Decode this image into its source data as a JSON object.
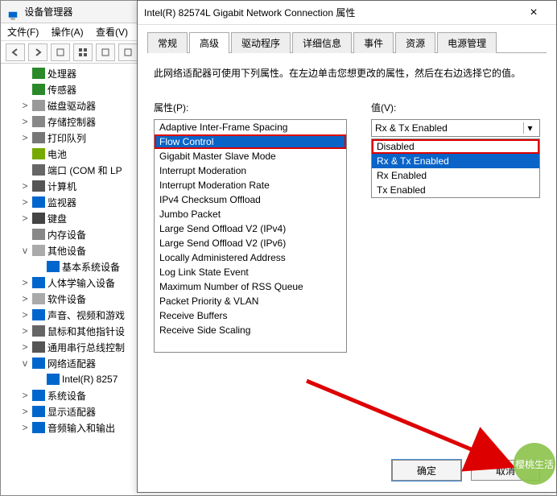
{
  "dm": {
    "title": "设备管理器",
    "menu": {
      "file": "文件(F)",
      "action": "操作(A)",
      "view": "查看(V)"
    },
    "tree": [
      {
        "exp": "",
        "icon": "ic-cpu",
        "label": "处理器",
        "indent": 1
      },
      {
        "exp": "",
        "icon": "ic-sensor",
        "label": "传感器",
        "indent": 1
      },
      {
        "exp": ">",
        "icon": "ic-disk",
        "label": "磁盘驱动器",
        "indent": 1
      },
      {
        "exp": ">",
        "icon": "ic-store",
        "label": "存储控制器",
        "indent": 1
      },
      {
        "exp": ">",
        "icon": "ic-print",
        "label": "打印队列",
        "indent": 1
      },
      {
        "exp": "",
        "icon": "ic-batt",
        "label": "电池",
        "indent": 1
      },
      {
        "exp": "",
        "icon": "ic-port",
        "label": "端口 (COM 和 LP",
        "indent": 1
      },
      {
        "exp": ">",
        "icon": "ic-pc",
        "label": "计算机",
        "indent": 1
      },
      {
        "exp": ">",
        "icon": "ic-mon",
        "label": "监视器",
        "indent": 1
      },
      {
        "exp": ">",
        "icon": "ic-kb",
        "label": "键盘",
        "indent": 1
      },
      {
        "exp": "",
        "icon": "ic-mem",
        "label": "内存设备",
        "indent": 1
      },
      {
        "exp": "v",
        "icon": "ic-other",
        "label": "其他设备",
        "indent": 1
      },
      {
        "exp": "",
        "icon": "ic-sys",
        "label": "基本系统设备",
        "indent": 2
      },
      {
        "exp": ">",
        "icon": "ic-hid",
        "label": "人体学输入设备",
        "indent": 1
      },
      {
        "exp": ">",
        "icon": "ic-soft",
        "label": "软件设备",
        "indent": 1
      },
      {
        "exp": ">",
        "icon": "ic-snd",
        "label": "声音、视频和游戏",
        "indent": 1
      },
      {
        "exp": ">",
        "icon": "ic-mouse",
        "label": "鼠标和其他指针设",
        "indent": 1
      },
      {
        "exp": ">",
        "icon": "ic-usb",
        "label": "通用串行总线控制",
        "indent": 1
      },
      {
        "exp": "v",
        "icon": "ic-net",
        "label": "网络适配器",
        "indent": 1
      },
      {
        "exp": "",
        "icon": "ic-nic",
        "label": "Intel(R) 8257",
        "indent": 2
      },
      {
        "exp": ">",
        "icon": "ic-sys",
        "label": "系统设备",
        "indent": 1
      },
      {
        "exp": ">",
        "icon": "ic-disp",
        "label": "显示适配器",
        "indent": 1
      },
      {
        "exp": ">",
        "icon": "ic-aud",
        "label": "音频输入和输出",
        "indent": 1
      }
    ]
  },
  "dlg": {
    "title": "Intel(R) 82574L Gigabit Network Connection 属性",
    "tabs": [
      "常规",
      "高级",
      "驱动程序",
      "详细信息",
      "事件",
      "资源",
      "电源管理"
    ],
    "active_tab": 1,
    "desc": "此网络适配器可使用下列属性。在左边单击您想更改的属性，然后在右边选择它的值。",
    "prop_label": "属性(P):",
    "val_label": "值(V):",
    "props": [
      "Adaptive Inter-Frame Spacing",
      "Flow Control",
      "Gigabit Master Slave Mode",
      "Interrupt Moderation",
      "Interrupt Moderation Rate",
      "IPv4 Checksum Offload",
      "Jumbo Packet",
      "Large Send Offload V2 (IPv4)",
      "Large Send Offload V2 (IPv6)",
      "Locally Administered Address",
      "Log Link State Event",
      "Maximum Number of RSS Queue",
      "Packet Priority & VLAN",
      "Receive Buffers",
      "Receive Side Scaling"
    ],
    "prop_selected": 1,
    "combo_value": "Rx & Tx Enabled",
    "values": [
      "Disabled",
      "Rx & Tx Enabled",
      "Rx Enabled",
      "Tx Enabled"
    ],
    "value_selected": 1,
    "value_highlight": 0,
    "ok": "确定",
    "cancel": "取消"
  },
  "watermark": "樱桃生活"
}
